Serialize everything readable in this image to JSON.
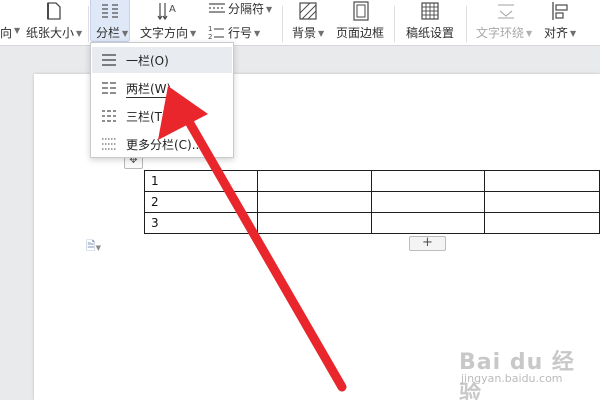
{
  "toolbar": {
    "partial_left": "向",
    "paper_size": "纸张大小",
    "columns": "分栏",
    "text_direction": "文字方向",
    "separator": "分隔符",
    "line_number": "行号",
    "background": "背景",
    "page_border": "页面边框",
    "manuscript": "稿纸设置",
    "text_wrap": "文字环绕",
    "align": "对齐"
  },
  "columns_menu": {
    "items": [
      {
        "label": "一栏(O)",
        "icon": "one-column-icon"
      },
      {
        "label": "两栏(W)",
        "icon": "two-columns-icon"
      },
      {
        "label": "三栏(T)",
        "icon": "three-columns-icon"
      },
      {
        "label": "更多分栏(C)...",
        "icon": "more-columns-icon"
      }
    ]
  },
  "document": {
    "table_rows": [
      [
        "1",
        "",
        "",
        ""
      ],
      [
        "2",
        "",
        "",
        ""
      ],
      [
        "3",
        "",
        "",
        ""
      ]
    ],
    "add_row_symbol": "+"
  },
  "watermark": {
    "main": "Bai du 经验",
    "sub": "jingyan.baidu.com"
  },
  "colors": {
    "arrow": "#e8262c",
    "menu_highlight": "#e8ebf0",
    "active_tool": "#dfe8f6"
  }
}
